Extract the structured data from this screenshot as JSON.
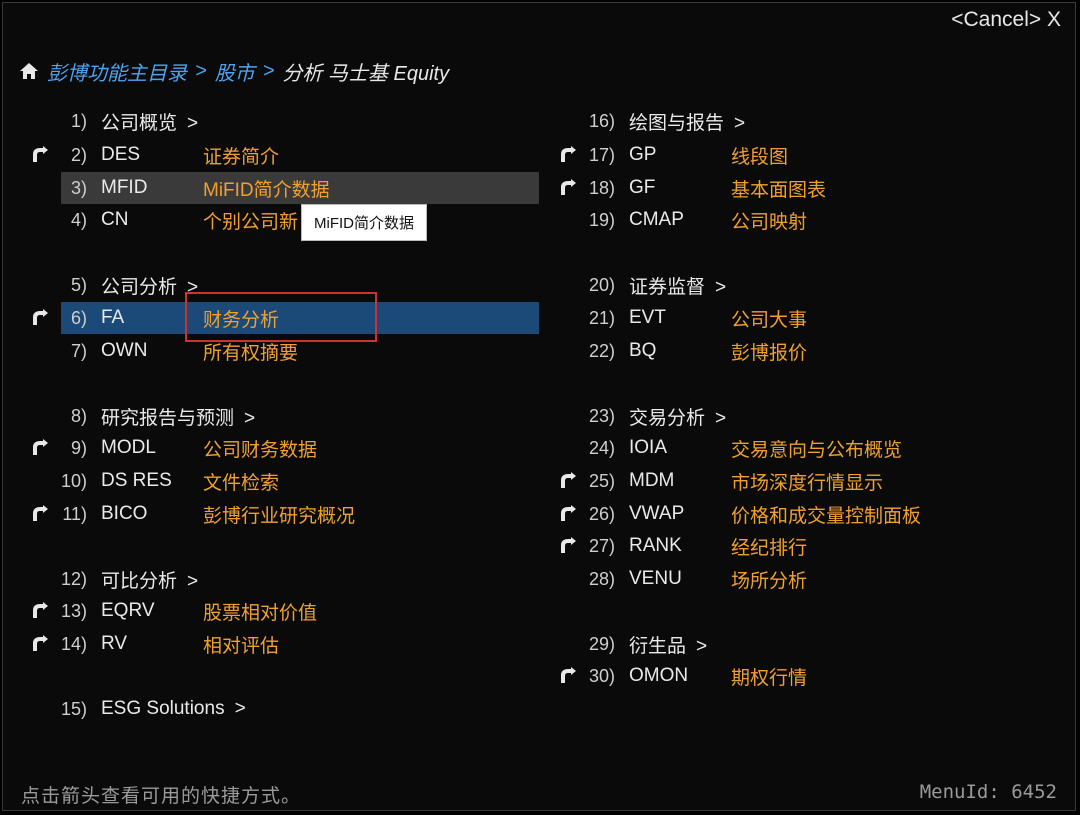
{
  "header": {
    "cancel_label": "<Cancel> X"
  },
  "breadcrumb": {
    "home_icon": "home-icon",
    "items": [
      "彭博功能主目录",
      "股市"
    ],
    "separator": ">",
    "current": "分析 马士基 Equity"
  },
  "left": {
    "sections": [
      {
        "num": "1)",
        "title": "公司概览",
        "chev": ">"
      },
      {
        "num": "5)",
        "title": "公司分析",
        "chev": ">"
      },
      {
        "num": "8)",
        "title": "研究报告与预测",
        "chev": ">"
      },
      {
        "num": "12)",
        "title": "可比分析",
        "chev": ">"
      },
      {
        "num": "15)",
        "title": "ESG Solutions",
        "chev": ">"
      }
    ],
    "items": [
      {
        "num": "2)",
        "code": "DES",
        "desc": "证券简介"
      },
      {
        "num": "3)",
        "code": "MFID",
        "desc": "MiFID简介数据"
      },
      {
        "num": "4)",
        "code": "CN",
        "desc": "个别公司新"
      },
      {
        "num": "6)",
        "code": "FA",
        "desc": "财务分析"
      },
      {
        "num": "7)",
        "code": "OWN",
        "desc": "所有权摘要"
      },
      {
        "num": "9)",
        "code": "MODL",
        "desc": "公司财务数据"
      },
      {
        "num": "10)",
        "code": "DS RES",
        "desc": "文件检索"
      },
      {
        "num": "11)",
        "code": "BICO",
        "desc": "彭博行业研究概况"
      },
      {
        "num": "13)",
        "code": "EQRV",
        "desc": "股票相对价值"
      },
      {
        "num": "14)",
        "code": "RV",
        "desc": "相对评估"
      }
    ]
  },
  "right": {
    "sections": [
      {
        "num": "16)",
        "title": "绘图与报告",
        "chev": ">"
      },
      {
        "num": "20)",
        "title": "证券监督",
        "chev": ">"
      },
      {
        "num": "23)",
        "title": "交易分析",
        "chev": ">"
      },
      {
        "num": "29)",
        "title": "衍生品",
        "chev": ">"
      }
    ],
    "items": [
      {
        "num": "17)",
        "code": "GP",
        "desc": "线段图"
      },
      {
        "num": "18)",
        "code": "GF",
        "desc": "基本面图表"
      },
      {
        "num": "19)",
        "code": "CMAP",
        "desc": "公司映射"
      },
      {
        "num": "21)",
        "code": "EVT",
        "desc": "公司大事"
      },
      {
        "num": "22)",
        "code": "BQ",
        "desc": "彭博报价"
      },
      {
        "num": "24)",
        "code": "IOIA",
        "desc": "交易意向与公布概览"
      },
      {
        "num": "25)",
        "code": "MDM",
        "desc": "市场深度行情显示"
      },
      {
        "num": "26)",
        "code": "VWAP",
        "desc": "价格和成交量控制面板"
      },
      {
        "num": "27)",
        "code": "RANK",
        "desc": "经纪排行"
      },
      {
        "num": "28)",
        "code": "VENU",
        "desc": "场所分析"
      },
      {
        "num": "30)",
        "code": "OMON",
        "desc": "期权行情"
      }
    ]
  },
  "tooltip": {
    "text": "MiFID简介数据"
  },
  "footer": {
    "hint": "点击箭头查看可用的快捷方式。",
    "menu_id": "MenuId: 6452"
  },
  "colors": {
    "link": "#4ea3f0",
    "desc": "#f0a030",
    "selected": "#1b4a78"
  },
  "icons": {
    "shortcut": "shortcut-arrow-icon"
  }
}
